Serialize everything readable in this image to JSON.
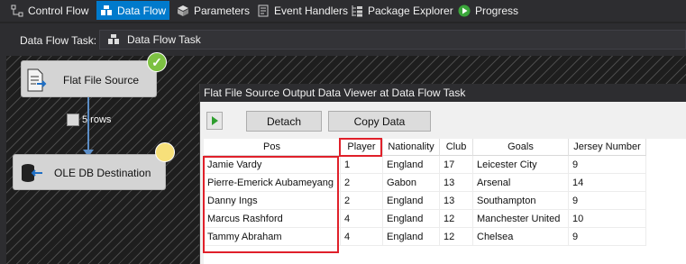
{
  "toolbar": {
    "tabs": [
      {
        "label": "Control Flow",
        "icon": "control-flow-icon"
      },
      {
        "label": "Data Flow",
        "icon": "data-flow-icon",
        "active": true
      },
      {
        "label": "Parameters",
        "icon": "parameters-icon"
      },
      {
        "label": "Event Handlers",
        "icon": "event-handlers-icon"
      },
      {
        "label": "Package Explorer",
        "icon": "package-explorer-icon"
      },
      {
        "label": "Progress",
        "icon": "progress-icon"
      }
    ]
  },
  "task": {
    "label": "Data Flow Task:",
    "value": "Data Flow Task"
  },
  "canvas": {
    "source": {
      "label": "Flat File Source",
      "status": "success"
    },
    "destination": {
      "label": "OLE DB Destination",
      "status": "pending"
    },
    "connector_label": "5 rows"
  },
  "viewer": {
    "title": "Flat File Source Output Data Viewer at Data Flow Task",
    "detach_label": "Detach",
    "copy_label": "Copy Data",
    "columns": [
      "Pos",
      "Player",
      "Nationality",
      "Club",
      "Goals",
      "Jersey Number"
    ],
    "rows": [
      [
        "Jamie Vardy",
        "1",
        "England",
        "17",
        "Leicester City",
        "9"
      ],
      [
        "Pierre-Emerick Aubameyang",
        "2",
        "Gabon",
        "13",
        "Arsenal",
        "14"
      ],
      [
        "Danny Ings",
        "2",
        "England",
        "13",
        "Southampton",
        "9"
      ],
      [
        "Marcus Rashford",
        "4",
        "England",
        "12",
        "Manchester United",
        "10"
      ],
      [
        "Tammy Abraham",
        "4",
        "England",
        "12",
        "Chelsea",
        "9"
      ]
    ]
  },
  "colors": {
    "accent": "#007acc",
    "highlight": "#e0202a",
    "success": "#7dc142"
  }
}
